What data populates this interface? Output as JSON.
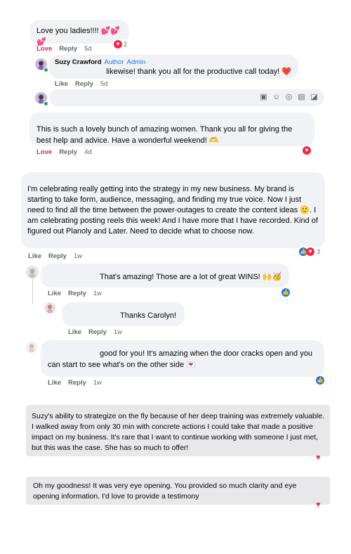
{
  "c1": {
    "text": "Love you ladies!!!! 💕💕💕",
    "love": "Love",
    "reply": "Reply",
    "time": "5d",
    "react_count": "2"
  },
  "c2": {
    "author": "Suzy Crawford",
    "badge1": "Author",
    "badge2": "Admin",
    "text": "likewise! thank you all for the productive call today! ❤️",
    "like": "Like",
    "reply": "Reply",
    "time": "5d"
  },
  "composer": {
    "placeholder": "",
    "icons": [
      "gif-icon",
      "emoji-icon",
      "camera-icon",
      "gif-box-icon",
      "sticker-icon"
    ]
  },
  "c3": {
    "text": "This is such a lovely bunch of amazing women. Thank you all for giving the best help and advice. Have a wonderful weekend! 🫶",
    "love": "Love",
    "reply": "Reply",
    "time": "4d"
  },
  "c4": {
    "text": "I'm celebrating really getting into the strategy in my new business. My brand is starting to take form, audience, messaging, and finding my true voice. Now I just need to find all the time between the power-outages to create the content ideas 🙂. I am celebrating posting reels this week! And I have more that I have recorded. Kind of figured out Planoly and Later. Need to decide what to choose now.",
    "like": "Like",
    "reply": "Reply",
    "time": "1w",
    "react_count": "3"
  },
  "c5": {
    "text": "That's amazing! Those are a lot of great WINS! 🙌🥳",
    "like": "Like",
    "reply": "Reply",
    "time": "1w"
  },
  "c6": {
    "text": "Thanks Carolyn!",
    "like": "Like",
    "reply": "Reply",
    "time": "1w"
  },
  "c7": {
    "text": "good for you! It's amazing when the door cracks open and you can start to see what's on the other side 💌",
    "like": "Like",
    "reply": "Reply",
    "time": "1w"
  },
  "t1": {
    "text": "Suzy's ability to strategize on the fly because of her deep training was extremely valuable.  I walked away from only 30 min with concrete actions I could take that made a positive impact on my business.  It's rare that I want to continue working with someone I just met, but this was the case.  She has so much to offer!"
  },
  "t2": {
    "text": "Oh my goodness! It was very eye opening. You provided so much clarity and eye opening information. I'd love to provide a testimony"
  },
  "colors": {
    "bubble": "#f0f2f5",
    "testimonial": "#e8e8ea",
    "love": "#e0244e",
    "heart": "#f02849",
    "like": "#1877f2",
    "muted": "#65676b"
  }
}
